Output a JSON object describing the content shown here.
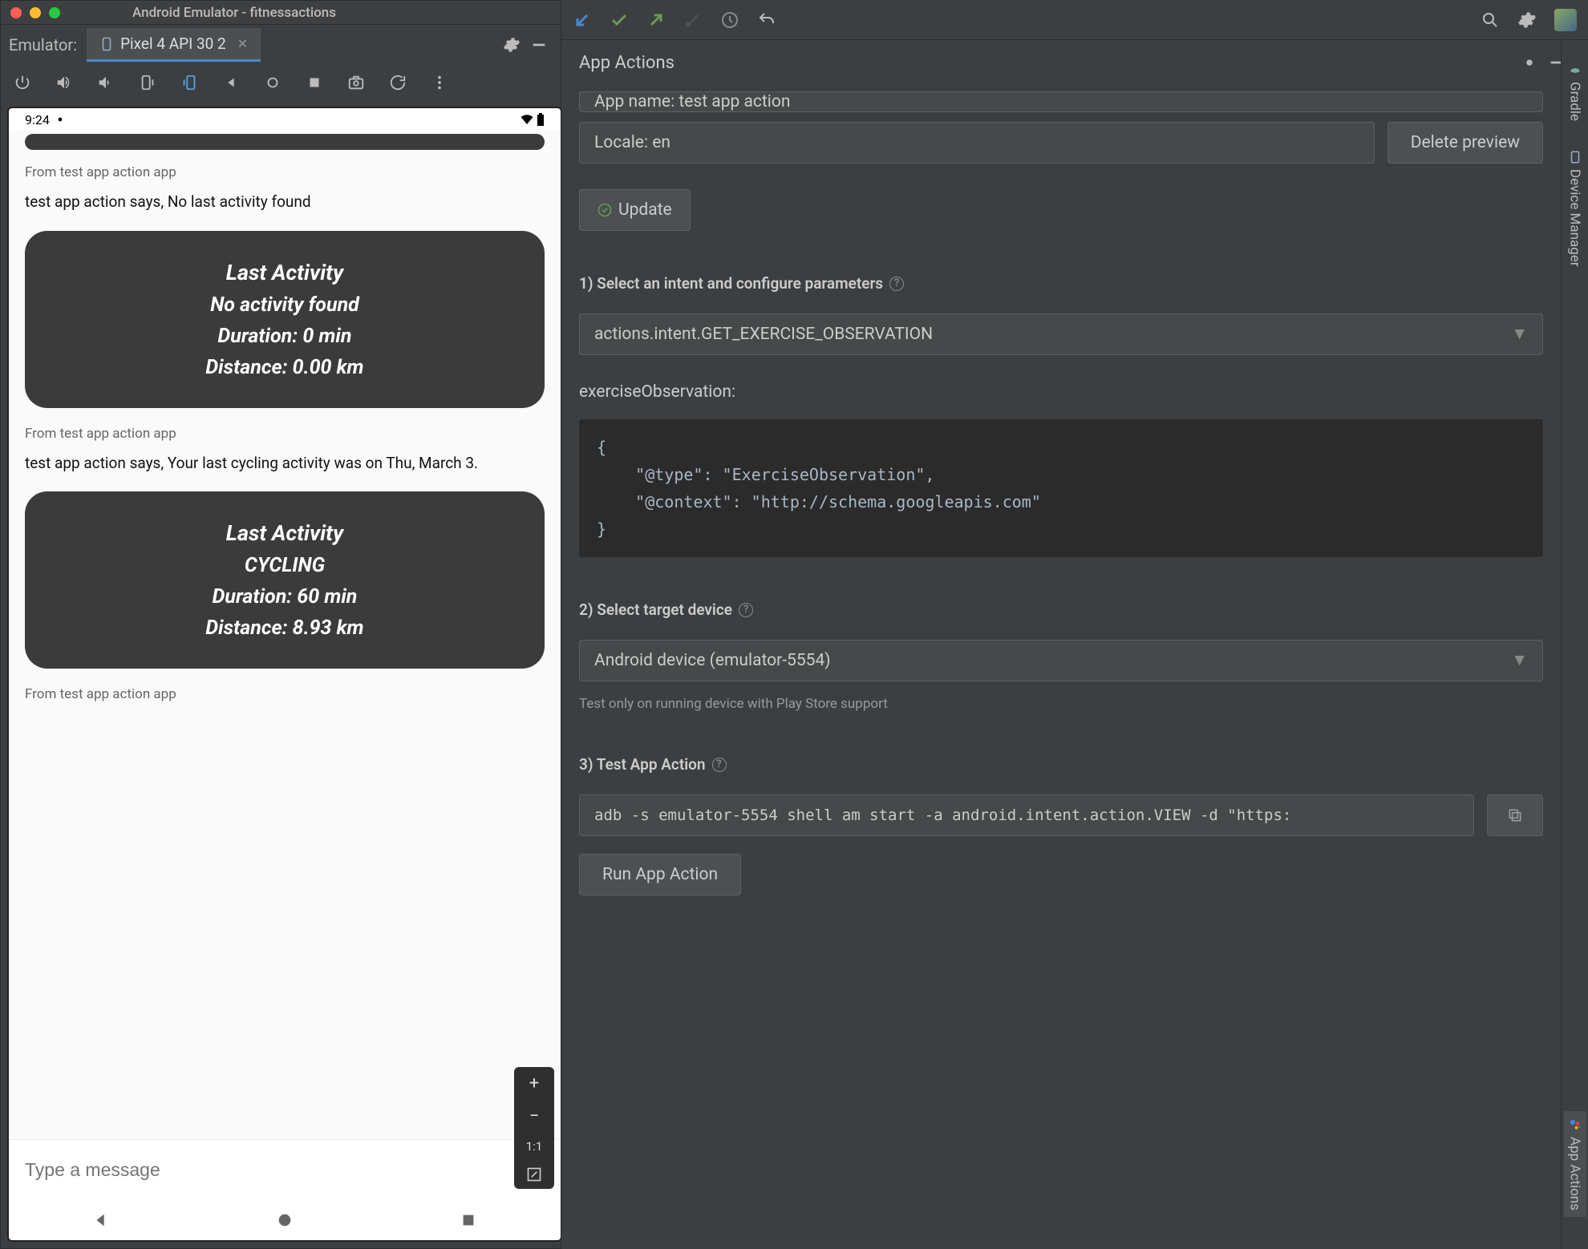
{
  "window": {
    "title": "Android Emulator - fitnessactions"
  },
  "emulator": {
    "label": "Emulator:",
    "tab": "Pixel 4 API 30 2"
  },
  "device": {
    "statusbar": {
      "time": "9:24"
    },
    "chat": {
      "from1": "From test app action app",
      "says1": "test app action says, No last activity found",
      "card1": {
        "title": "Last Activity",
        "status": "No activity found",
        "duration": "Duration: 0 min",
        "distance": "Distance: 0.00 km"
      },
      "from2": "From test app action app",
      "says2": "test app action says, Your last cycling activity was on Thu, March 3.",
      "card2": {
        "title": "Last Activity",
        "status": "CYCLING",
        "duration": "Duration: 60 min",
        "distance": "Distance: 8.93 km"
      },
      "from3": "From test app action app",
      "input_placeholder": "Type a message"
    },
    "zoom": {
      "plus": "+",
      "minus": "−",
      "fit": "1:1"
    }
  },
  "panel": {
    "header": "App Actions",
    "app_name": "App name: test app action",
    "locale": "Locale: en",
    "delete_btn": "Delete preview",
    "update_btn": "Update",
    "step1": "1) Select an intent and configure parameters",
    "intent": "actions.intent.GET_EXERCISE_OBSERVATION",
    "param_label": "exerciseObservation:",
    "code": "{\n    \"@type\": \"ExerciseObservation\",\n    \"@context\": \"http://schema.googleapis.com\"\n}",
    "step2": "2) Select target device",
    "device_sel": "Android device (emulator-5554)",
    "hint2": "Test only on running device with Play Store support",
    "step3": "3) Test App Action",
    "adb": "adb -s emulator-5554 shell am start -a android.intent.action.VIEW -d \"https:",
    "run_btn": "Run App Action"
  },
  "righttabs": {
    "gradle": "Gradle",
    "devmgr": "Device Manager",
    "appactions": "App Actions"
  }
}
